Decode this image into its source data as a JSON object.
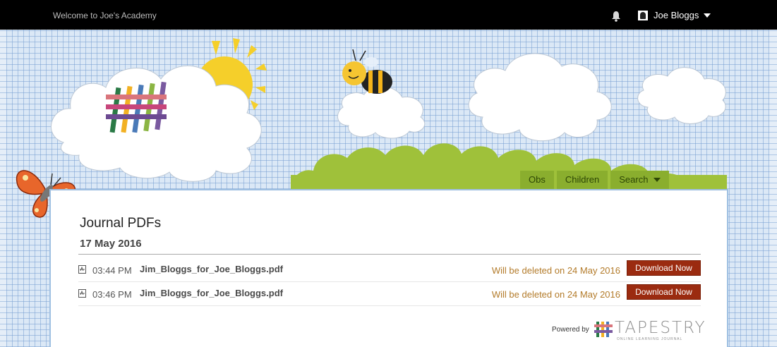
{
  "topbar": {
    "welcome": "Welcome to Joe's Academy",
    "user_name": "Joe Bloggs"
  },
  "nav": {
    "items": [
      {
        "label": "Obs"
      },
      {
        "label": "Children"
      },
      {
        "label": "Search"
      }
    ]
  },
  "main": {
    "title": "Journal PDFs",
    "date": "17 May 2016",
    "rows": [
      {
        "time": "03:44 PM",
        "filename": "Jim_Bloggs_for_Joe_Bloggs.pdf",
        "status": "Will be deleted on 24 May 2016",
        "action": "Download Now"
      },
      {
        "time": "03:46 PM",
        "filename": "Jim_Bloggs_for_Joe_Bloggs.pdf",
        "status": "Will be deleted on 24 May 2016",
        "action": "Download Now"
      }
    ]
  },
  "footer": {
    "powered_by": "Powered by",
    "brand": "TAPESTRY",
    "brand_sub": "ONLINE LEARNING JOURNAL"
  },
  "icons": {
    "bell": "bell-icon",
    "user": "user-icon",
    "caret": "caret-down-icon",
    "pdf": "pdf-file-icon"
  },
  "colors": {
    "accent_green": "#8aae2e",
    "download_button": "#9b2b10",
    "deleted_text": "#b37b2a",
    "topbar": "#000000"
  }
}
